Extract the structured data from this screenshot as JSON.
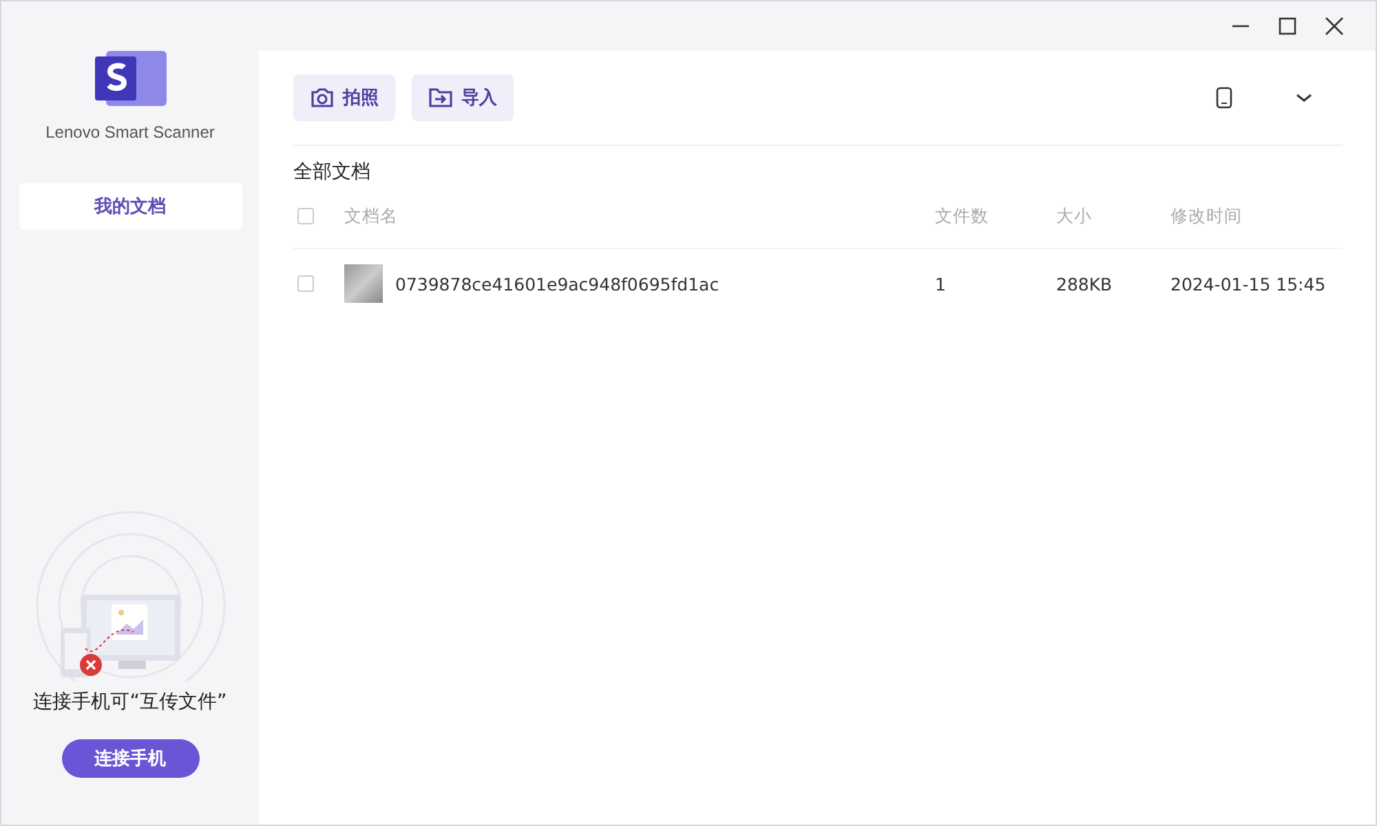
{
  "app": {
    "name": "Lenovo Smart Scanner"
  },
  "sidebar": {
    "items": [
      {
        "label": "我的文档",
        "selected": true
      }
    ]
  },
  "connect": {
    "caption": "连接手机可“互传文件”",
    "button": "连接手机"
  },
  "toolbar": {
    "buttons": [
      {
        "label": "拍照",
        "kind": "camera"
      },
      {
        "label": "导入",
        "kind": "import"
      }
    ]
  },
  "section_title": "全部文档",
  "table": {
    "columns": [
      "文档名",
      "文件数",
      "大小",
      "修改时间"
    ],
    "all_checked": false,
    "rows": [
      {
        "name": "0739878ce41601e9ac948f0695fd1ac",
        "count": "1",
        "size": "288KB",
        "modified": "2024-01-15 15:45",
        "checked": false
      }
    ]
  }
}
